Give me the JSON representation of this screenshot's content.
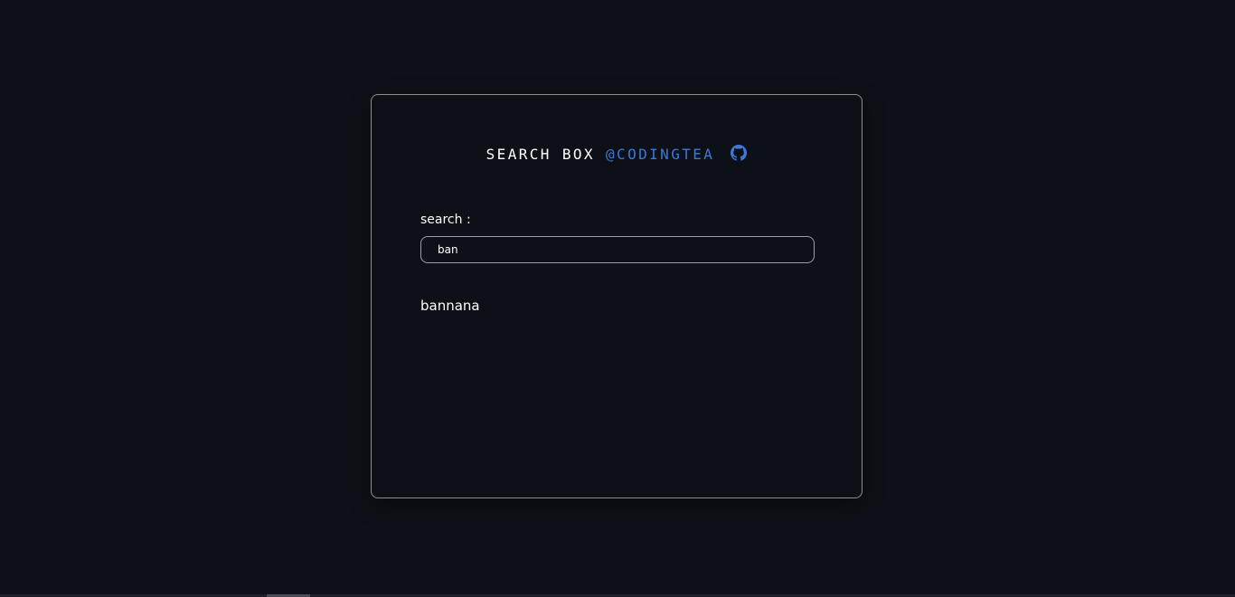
{
  "header": {
    "title": "SEARCH BOX",
    "handle": "@CODINGTEA",
    "icon": "github-icon"
  },
  "search": {
    "label": "search :",
    "value": "ban",
    "placeholder": ""
  },
  "results": [
    {
      "label": "bannana"
    }
  ],
  "colors": {
    "background": "#0d1016",
    "accent": "#3b79d9",
    "text": "#ffffff",
    "border": "#8a8d92"
  }
}
